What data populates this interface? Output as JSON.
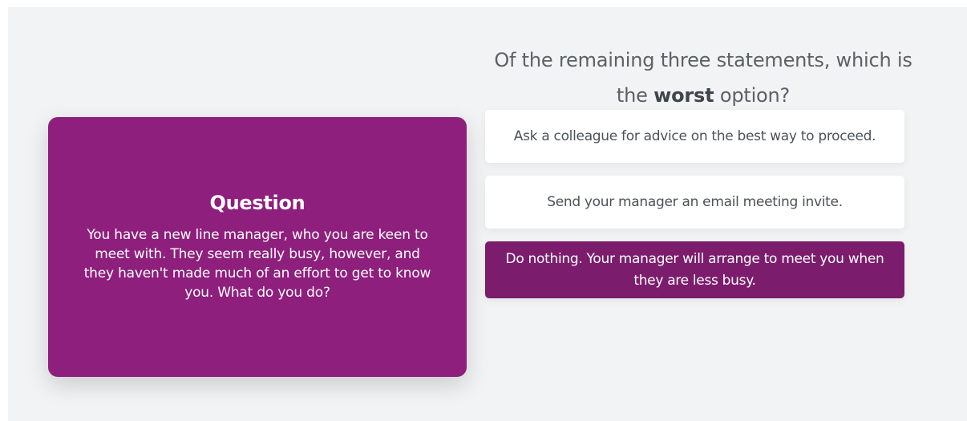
{
  "question": {
    "title": "Question",
    "text": "You have a new line manager, who you are keen to meet with. They seem really busy, however, and they haven't made much of an effort to get to know you. What do you do?"
  },
  "prompt": {
    "before": "Of the remaining three statements, which is the ",
    "emphasis": "worst",
    "after": " option?"
  },
  "options": [
    {
      "label": "Ask a colleague for advice on the best way to proceed.",
      "selected": false
    },
    {
      "label": "Send your manager an email meeting invite.",
      "selected": false
    },
    {
      "label": "Do nothing. Your manager will arrange to meet you when they are less busy.",
      "selected": true
    }
  ],
  "colors": {
    "card": "#8e1f7d",
    "selected_option": "#7c1c6c",
    "background": "#f2f3f4"
  }
}
